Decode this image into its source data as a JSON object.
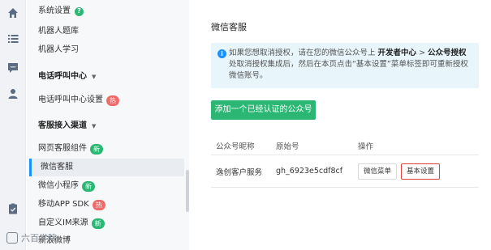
{
  "rail": {
    "icons": [
      "home-icon",
      "list-icon",
      "chat-icon",
      "user-icon",
      "clipboard-icon"
    ]
  },
  "sidebar": {
    "items_top": [
      {
        "label": "系统设置",
        "help": "?"
      },
      {
        "label": "机器人题库"
      },
      {
        "label": "机器人学习"
      }
    ],
    "group_call": {
      "label": "电话呼叫中心",
      "caret": "▼"
    },
    "call_settings": {
      "label": "电话呼叫中心设置",
      "badge": "热"
    },
    "group_channels": {
      "label": "客服接入渠道",
      "caret": "▼"
    },
    "channels": [
      {
        "label": "网页客服组件",
        "badge": "新",
        "badge_color": "green"
      },
      {
        "label": "微信客服",
        "active": true
      },
      {
        "label": "微信小程序",
        "badge": "新",
        "badge_color": "green"
      },
      {
        "label": "移动APP SDK",
        "badge": "热",
        "badge_color": "red"
      },
      {
        "label": "自定义IM来源",
        "badge": "新",
        "badge_color": "green"
      },
      {
        "label": "新浪微博"
      }
    ],
    "watermark": "六百学院"
  },
  "main": {
    "title": "微信客服",
    "notice": {
      "icon": "i",
      "text_1": "如果您想取消授权，请在您的微信公众号上 ",
      "bold_1": "开发者中心",
      "text_2": " > ",
      "bold_2": "公众号授权",
      "text_3": " 处取消授权集成后，然后在本页点击“基本设置”菜单标签即可重新授权微信账号。"
    },
    "add_button": "添加一个已经认证的公众号",
    "table": {
      "headers": [
        "公众号昵称",
        "原始号",
        "操作"
      ],
      "rows": [
        {
          "nickname": "逸创客户服务",
          "raw_id": "gh_6923e5cdf8cf",
          "actions": [
            "微信菜单",
            "基本设置"
          ]
        }
      ]
    }
  },
  "colors": {
    "accent_green": "#2bb673",
    "badge_red": "#f06a6a",
    "notice_bg": "#e8f5fb",
    "highlight_border": "#e23c3c"
  }
}
